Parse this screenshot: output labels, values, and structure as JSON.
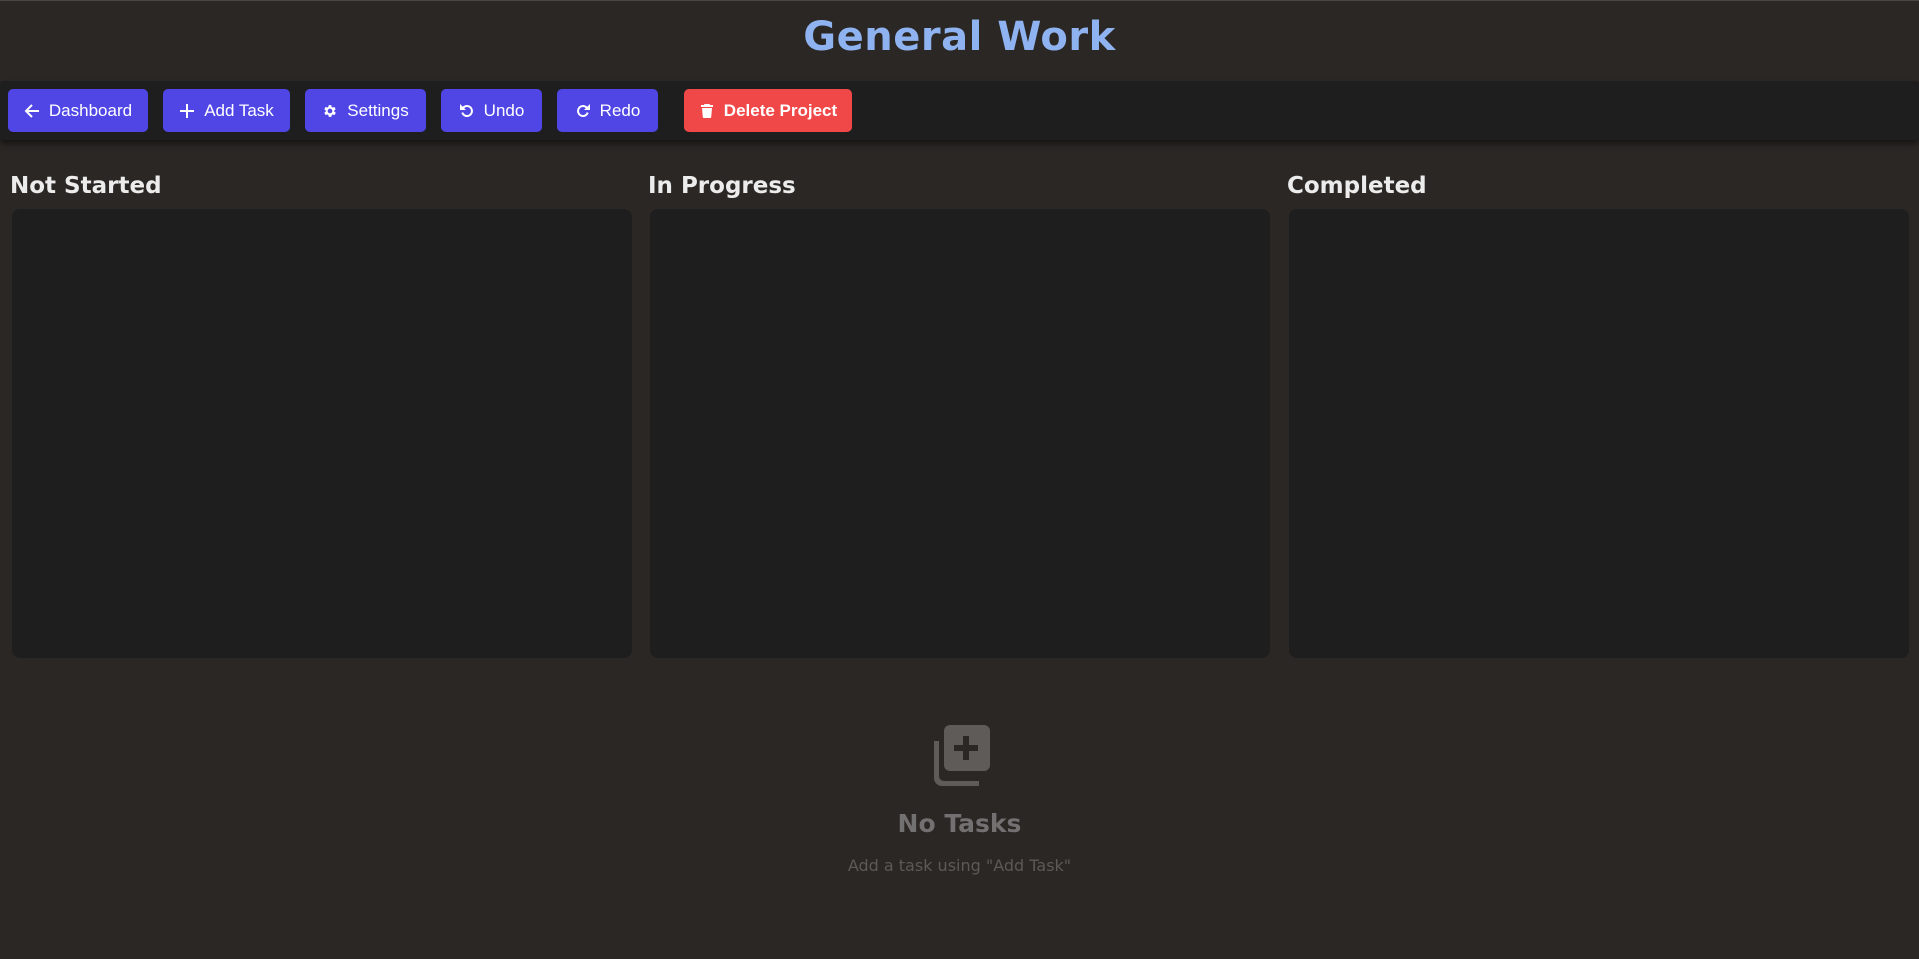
{
  "header": {
    "title": "General Work"
  },
  "toolbar": {
    "dashboard_label": "Dashboard",
    "add_task_label": "Add Task",
    "settings_label": "Settings",
    "undo_label": "Undo",
    "redo_label": "Redo",
    "delete_project_label": "Delete Project",
    "icons": [
      "arrow-left-icon",
      "plus-icon",
      "gear-icon",
      "undo-icon",
      "redo-icon",
      "trash-icon"
    ]
  },
  "columns": [
    {
      "title": "Not Started"
    },
    {
      "title": "In Progress"
    },
    {
      "title": "Completed"
    }
  ],
  "empty_state": {
    "icon": "add-copy-icon",
    "title": "No Tasks",
    "subtitle": "Add a task using \"Add Task\""
  },
  "colors": {
    "background": "#2b2725",
    "title": "#8fb3f0",
    "accent": "#4f46e5",
    "danger": "#f04848",
    "panel": "#1f1e1e"
  }
}
